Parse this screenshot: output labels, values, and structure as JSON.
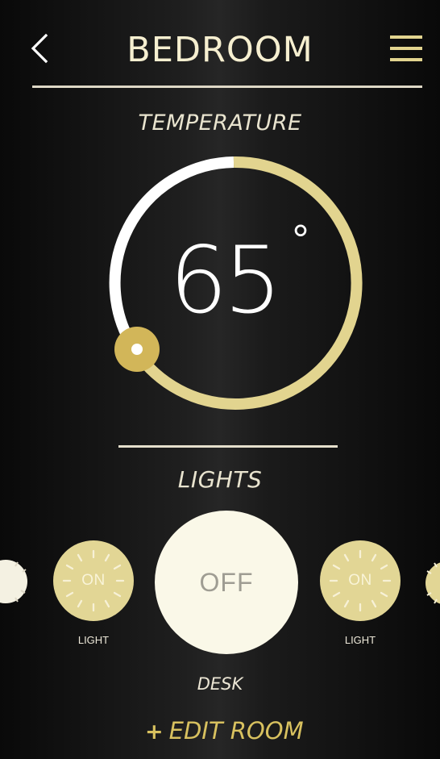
{
  "header": {
    "title": "BEDROOM",
    "back_icon": "chevron-left-icon",
    "menu_icon": "hamburger-menu-icon"
  },
  "temperature": {
    "label": "TEMPERATURE",
    "value": "65",
    "unit": "°"
  },
  "lights": {
    "label": "LIGHTS",
    "items": [
      {
        "name": "LIGHT",
        "state": "ON"
      },
      {
        "name": "DESK",
        "state": "OFF"
      },
      {
        "name": "LIGHT",
        "state": "ON"
      }
    ]
  },
  "actions": {
    "edit_room": "EDIT ROOM",
    "plus_icon": "+"
  },
  "colors": {
    "accent": "#e2d48f",
    "gold_text": "#d8c15f",
    "background": "#0b0b0b",
    "dial_white": "#ffffff"
  }
}
